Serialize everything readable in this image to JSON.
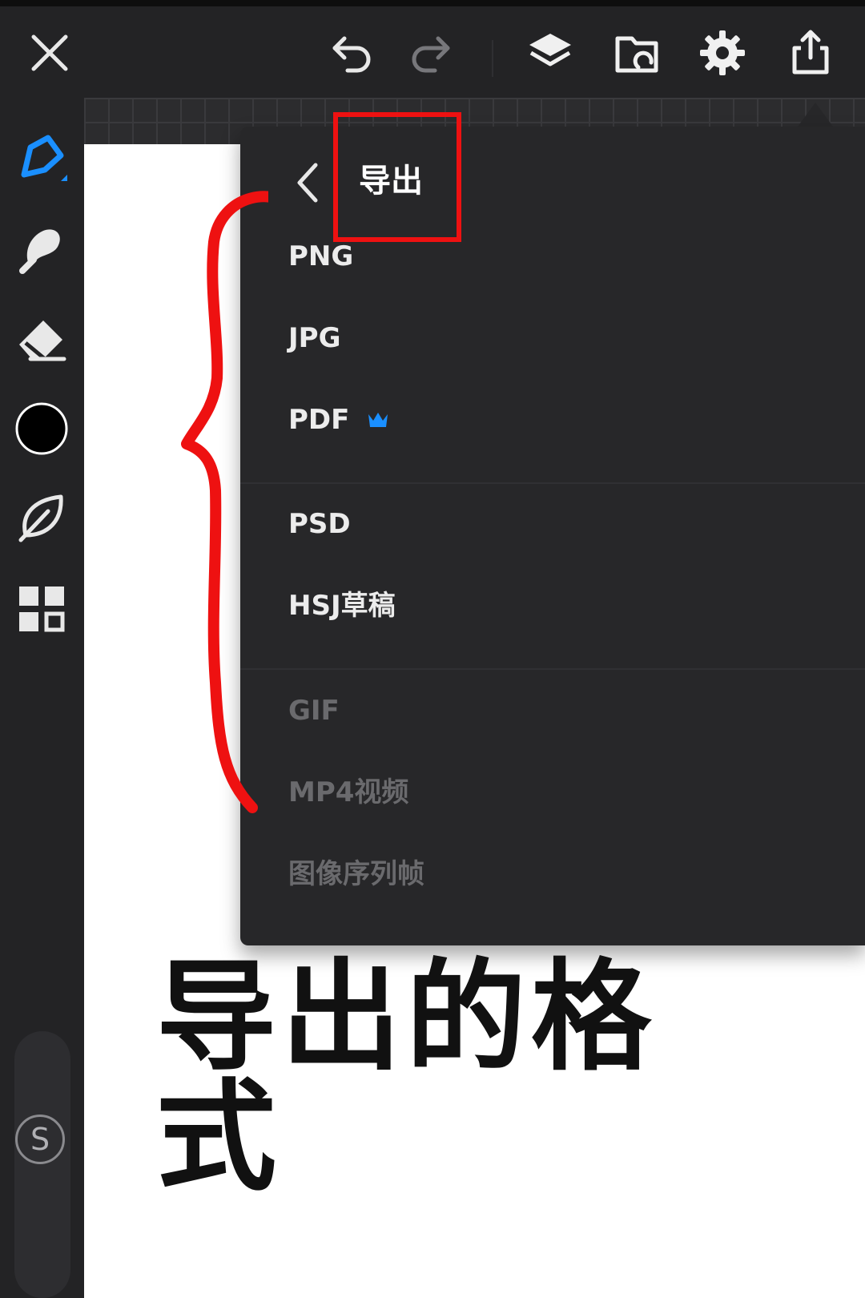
{
  "toolbar": {
    "close_icon": "close-icon",
    "undo_icon": "undo-icon",
    "redo_icon": "redo-icon",
    "layers_icon": "layers-icon",
    "gallery_icon": "gallery-icon",
    "settings_icon": "gear-icon",
    "share_icon": "share-icon"
  },
  "sidebar": {
    "tools": [
      "pen-tool-icon",
      "smudge-tool-icon",
      "eraser-icon",
      "color-swatch",
      "leaf-icon",
      "grid-apps-icon"
    ],
    "active_color": "#000000",
    "badge": "S"
  },
  "export_menu": {
    "title": "导出",
    "groups": [
      [
        {
          "label": "PNG",
          "enabled": true
        },
        {
          "label": "JPG",
          "enabled": true
        },
        {
          "label": "PDF",
          "enabled": true,
          "premium": true
        }
      ],
      [
        {
          "label": "PSD",
          "enabled": true
        },
        {
          "label": "HSJ草稿",
          "enabled": true
        }
      ],
      [
        {
          "label": "GIF",
          "enabled": false
        },
        {
          "label": "MP4视频",
          "enabled": false
        },
        {
          "label": "图像序列帧",
          "enabled": false
        }
      ]
    ]
  },
  "annotation": {
    "caption": "导出的格式",
    "highlight_color": "#ee1111",
    "accent_color": "#1a8fff"
  }
}
